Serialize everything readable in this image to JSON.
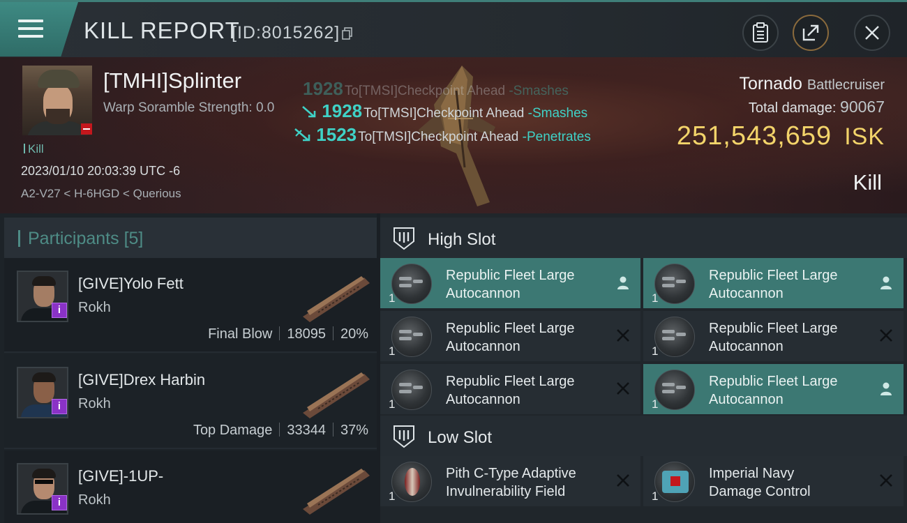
{
  "header": {
    "title": "KILL REPORT",
    "report_id": "[ID:8015262]",
    "icons": [
      "menu-icon",
      "copy-icon",
      "clipboard-icon",
      "share-icon",
      "close-icon"
    ]
  },
  "victim": {
    "name": "[TMHI]Splinter",
    "scramble": "Warp Soramble Strength: 0.0",
    "kill_tag": "Kill",
    "datetime": "2023/01/10 20:03:39 UTC -6",
    "location": "A2-V27 < H-6HGD < Querious",
    "ship": "Tornado",
    "ship_class": "Battlecruiser",
    "total_damage_label": "Total damage:",
    "total_damage": "90067",
    "isk_value": "251,543,659",
    "isk_unit": "ISK",
    "result": "Kill"
  },
  "hits": [
    {
      "amount": "1928",
      "target": "To[TMSI]Checkpoint Ahead",
      "verb": "-Smashes"
    },
    {
      "amount": "1523",
      "target": "To[TMSI]Checkpoint Ahead",
      "verb": "-Penetrates"
    }
  ],
  "participants": {
    "label": "Participants",
    "count": "[5]",
    "items": [
      {
        "name": "[GIVE]Yolo Fett",
        "ship": "Rokh",
        "tag": "Final Blow",
        "damage": "18095",
        "pct": "20%"
      },
      {
        "name": "[GIVE]Drex Harbin",
        "ship": "Rokh",
        "tag": "Top Damage",
        "damage": "33344",
        "pct": "37%"
      },
      {
        "name": "[GIVE]-1UP-",
        "ship": "Rokh",
        "tag": "",
        "damage": "",
        "pct": ""
      }
    ]
  },
  "slots": {
    "high": {
      "label": "High Slot",
      "modules": [
        {
          "line1": "Republic Fleet Large",
          "line2": "Autocannon",
          "qty": "1",
          "state": "person-icon",
          "active": true
        },
        {
          "line1": "Republic Fleet Large",
          "line2": "Autocannon",
          "qty": "1",
          "state": "person-icon",
          "active": true
        },
        {
          "line1": "Republic Fleet Large",
          "line2": "Autocannon",
          "qty": "1",
          "state": "x-icon",
          "active": false
        },
        {
          "line1": "Republic Fleet Large",
          "line2": "Autocannon",
          "qty": "1",
          "state": "x-icon",
          "active": false
        },
        {
          "line1": "Republic Fleet Large",
          "line2": "Autocannon",
          "qty": "1",
          "state": "x-icon",
          "active": false
        },
        {
          "line1": "Republic Fleet Large",
          "line2": "Autocannon",
          "qty": "1",
          "state": "person-icon",
          "active": true
        }
      ]
    },
    "low": {
      "label": "Low Slot",
      "modules": [
        {
          "line1": "Pith C-Type Adaptive",
          "line2": "Invulnerability Field",
          "qty": "1",
          "state": "x-icon",
          "active": false
        },
        {
          "line1": "Imperial Navy",
          "line2": "Damage Control",
          "qty": "1",
          "state": "x-icon",
          "active": false
        }
      ]
    }
  },
  "colors": {
    "accent_teal": "#3c7873",
    "hit_teal": "#3fd2c7",
    "isk_gold": "#f3d46a",
    "badge_purple": "#8a32c6",
    "badge_red": "#c3171d"
  }
}
